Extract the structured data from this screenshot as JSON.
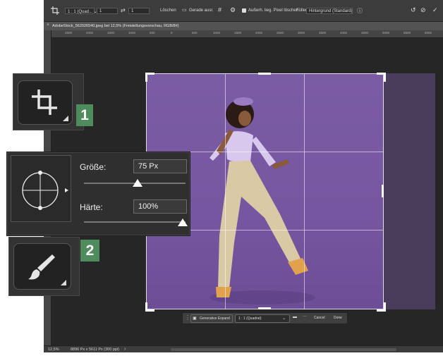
{
  "options_bar": {
    "ratio_select": "1 : 1 (Quad... ⌄",
    "width_value": "1",
    "height_value": "1",
    "clear_label": "Löschen",
    "straighten_label": "Gerade ausr.",
    "delete_cropped_label": "Außerh. lieg. Pixel löschen",
    "fill_label": "Füllen:",
    "fill_select": "Hintergrund (Standard)"
  },
  "document_tab": {
    "title": "AdobeStock_562026540.jpeg bei 12,5% (Freistellungsvorschau, RGB/8#)"
  },
  "ruler_ticks": [
    "2500",
    "2000",
    "1500",
    "1000",
    "500",
    "0",
    "500",
    "1000",
    "1500",
    "2000",
    "2500",
    "3000",
    "3500",
    "4000",
    "4500",
    "5000",
    "5500",
    "6000"
  ],
  "status_bar": {
    "zoom": "12,5%",
    "dimensions": "8896 Px x 5611 Px (300 ppi)",
    "arrow": "›"
  },
  "crop_bar": {
    "generative_expand": "Generative Expand",
    "ratio": "1 : 1 (Quadrat)",
    "more": "···",
    "cancel": "Cancel",
    "done": "Done"
  },
  "callout_1": {
    "number": "1"
  },
  "callout_2": {
    "number": "2"
  },
  "brush_settings": {
    "size_label": "Größe:",
    "size_value": "75 Px",
    "size_level": 0.53,
    "hardness_label": "Härte:",
    "hardness_value": "100%",
    "hardness_level": 1.0
  },
  "colors": {
    "badge_green": "#4e8c5d",
    "photo_purple": "#7656a0"
  }
}
